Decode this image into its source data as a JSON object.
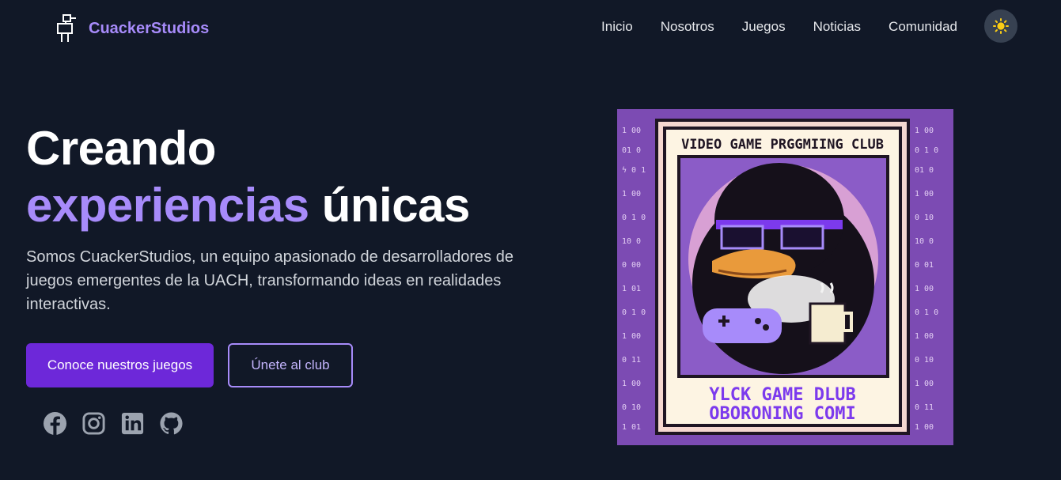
{
  "brand": {
    "name": "CuackerStudios"
  },
  "nav": {
    "items": [
      {
        "label": "Inicio"
      },
      {
        "label": "Nosotros"
      },
      {
        "label": "Juegos"
      },
      {
        "label": "Noticias"
      },
      {
        "label": "Comunidad"
      }
    ],
    "theme_toggle_icon": "sun-icon"
  },
  "hero": {
    "title_line1": "Creando",
    "title_accent": "experiencias",
    "title_rest": " únicas",
    "description": "Somos CuackerStudios, un equipo apasionado de desarrolladores de juegos emergentes de la UACH, transformando ideas en realidades interactivas.",
    "primary_button": "Conoce nuestros juegos",
    "secondary_button": "Únete al club"
  },
  "socials": [
    {
      "icon": "facebook-icon"
    },
    {
      "icon": "instagram-icon"
    },
    {
      "icon": "linkedin-icon"
    },
    {
      "icon": "github-icon"
    }
  ],
  "poster": {
    "top_text": "VIDEO GAME PRGGMIING CLUB",
    "bottom_line1": "YLCK GAME DLUB",
    "bottom_line2": "OBORONING COMI"
  },
  "colors": {
    "background": "#111827",
    "accent": "#a78bfa",
    "primary": "#6d28d9",
    "poster_purple": "#7c3aed"
  }
}
